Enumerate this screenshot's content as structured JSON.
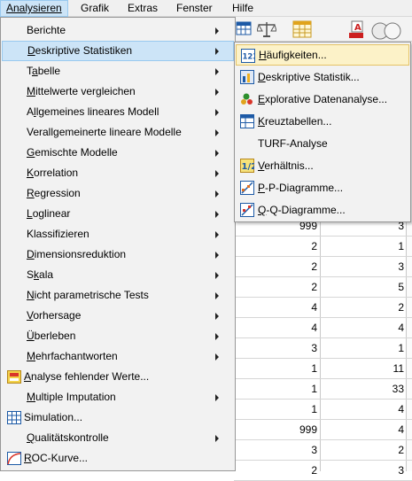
{
  "menubar": {
    "items": [
      {
        "label": "Analysieren"
      },
      {
        "label": "Grafik"
      },
      {
        "label": "Extras"
      },
      {
        "label": "Fenster"
      },
      {
        "label": "Hilfe"
      }
    ]
  },
  "toolbar": {
    "icons": [
      "table-grid-icon",
      "balance-scale-icon",
      "grid-table-icon",
      "pie-a-icon",
      "venn-circles-icon"
    ]
  },
  "analysieren_menu": {
    "items": [
      {
        "label": "Berichte",
        "submenu": true
      },
      {
        "label": "Deskriptive Statistiken",
        "submenu": true,
        "highlighted": true
      },
      {
        "label": "Tabelle",
        "submenu": true
      },
      {
        "label": "Mittelwerte vergleichen",
        "submenu": true
      },
      {
        "label": "Allgemeines lineares Modell",
        "submenu": true
      },
      {
        "label": "Verallgemeinerte lineare Modelle",
        "submenu": true
      },
      {
        "label": "Gemischte Modelle",
        "submenu": true
      },
      {
        "label": "Korrelation",
        "submenu": true
      },
      {
        "label": "Regression",
        "submenu": true
      },
      {
        "label": "Loglinear",
        "submenu": true
      },
      {
        "label": "Klassifizieren",
        "submenu": true
      },
      {
        "label": "Dimensionsreduktion",
        "submenu": true
      },
      {
        "label": "Skala",
        "submenu": true
      },
      {
        "label": "Nicht parametrische Tests",
        "submenu": true
      },
      {
        "label": "Vorhersage",
        "submenu": true
      },
      {
        "label": "Überleben",
        "submenu": true
      },
      {
        "label": "Mehrfachantworten",
        "submenu": true
      },
      {
        "label": "Analyse fehlender Werte...",
        "submenu": false,
        "icon": "missing-values-icon"
      },
      {
        "label": "Multiple Imputation",
        "submenu": true
      },
      {
        "label": "Simulation...",
        "submenu": false,
        "icon": "simulation-icon"
      },
      {
        "label": "Qualitätskontrolle",
        "submenu": true
      },
      {
        "label": "ROC-Kurve...",
        "submenu": false,
        "icon": "roc-curve-icon"
      }
    ]
  },
  "descriptive_submenu": {
    "items": [
      {
        "label": "Häufigkeiten...",
        "icon": "frequencies-icon",
        "highlighted": true
      },
      {
        "label": "Deskriptive Statistik...",
        "icon": "descriptives-icon"
      },
      {
        "label": "Explorative Datenanalyse...",
        "icon": "explore-icon"
      },
      {
        "label": "Kreuztabellen...",
        "icon": "crosstabs-icon"
      },
      {
        "label": "TURF-Analyse",
        "icon": ""
      },
      {
        "label": "Verhältnis...",
        "icon": "ratio-icon"
      },
      {
        "label": "P-P-Diagramme...",
        "icon": "pp-plot-icon"
      },
      {
        "label": "Q-Q-Diagramme...",
        "icon": "qq-plot-icon"
      }
    ]
  },
  "data_grid": {
    "rows": [
      [
        "999",
        "3"
      ],
      [
        "2",
        "1"
      ],
      [
        "2",
        "3"
      ],
      [
        "2",
        "5"
      ],
      [
        "4",
        "2"
      ],
      [
        "4",
        "4"
      ],
      [
        "3",
        "1"
      ],
      [
        "1",
        "11"
      ],
      [
        "1",
        "33"
      ],
      [
        "1",
        "4"
      ],
      [
        "999",
        "4"
      ],
      [
        "3",
        "2"
      ],
      [
        "2",
        "3"
      ]
    ]
  }
}
